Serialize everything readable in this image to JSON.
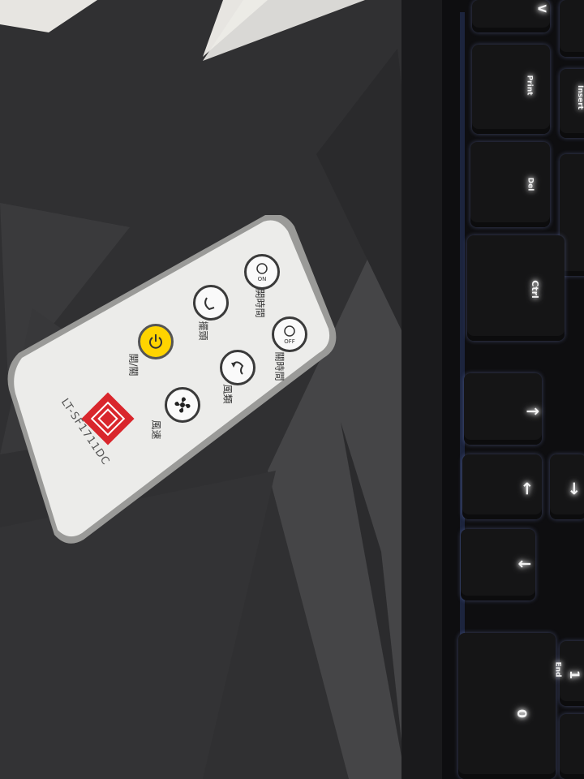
{
  "remote": {
    "model": "LT-SF1711DC",
    "buttons": [
      {
        "id": "on-timer",
        "label": "開時間",
        "icon_text": "ON"
      },
      {
        "id": "off-timer",
        "label": "關時間",
        "icon_text": "OFF"
      },
      {
        "id": "swing",
        "label": "擺頭"
      },
      {
        "id": "wind-mode",
        "label": "風類"
      },
      {
        "id": "power",
        "label": "開/關"
      },
      {
        "id": "speed",
        "label": "風速"
      }
    ],
    "brand_color": "#d9262c",
    "power_color": "#ffd400"
  },
  "keyboard": {
    "keys": [
      "V",
      "Print",
      "Insert",
      "Del",
      "Ctrl",
      "↑",
      "←",
      "↓",
      "→",
      "End",
      "0",
      "1"
    ]
  }
}
